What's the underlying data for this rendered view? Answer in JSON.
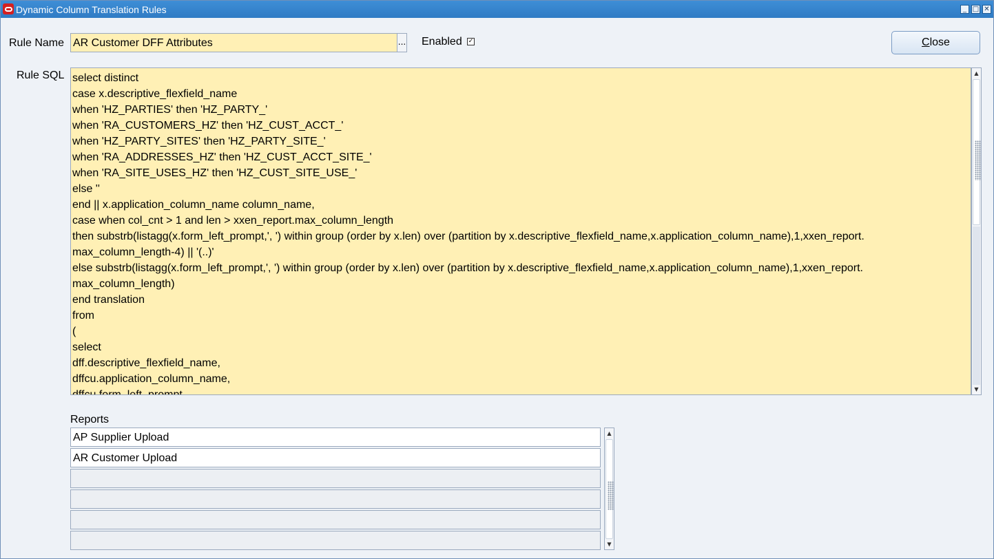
{
  "window": {
    "title": "Dynamic Column Translation Rules",
    "controls": [
      "_",
      "□",
      "✕"
    ]
  },
  "rule_name": {
    "label": "Rule Name",
    "value": "AR Customer DFF Attributes",
    "lov_label": "..."
  },
  "enabled": {
    "label": "Enabled",
    "checked": true,
    "mark": "✓"
  },
  "close_button": {
    "label": "Close",
    "mnemonic": "C"
  },
  "rule_sql": {
    "label": "Rule SQL",
    "lines": [
      "select distinct",
      "case x.descriptive_flexfield_name",
      "when 'HZ_PARTIES' then 'HZ_PARTY_'",
      "when 'RA_CUSTOMERS_HZ' then 'HZ_CUST_ACCT_'",
      "when 'HZ_PARTY_SITES' then 'HZ_PARTY_SITE_'",
      "when 'RA_ADDRESSES_HZ' then 'HZ_CUST_ACCT_SITE_'",
      "when 'RA_SITE_USES_HZ' then 'HZ_CUST_SITE_USE_'",
      "else ''",
      "end || x.application_column_name column_name,",
      "case when col_cnt > 1 and len > xxen_report.max_column_length",
      "then substrb(listagg(x.form_left_prompt,', ') within group (order by x.len) over (partition by x.descriptive_flexfield_name,x.application_column_name),1,xxen_report.",
      "max_column_length-4) || '(..)'",
      "else substrb(listagg(x.form_left_prompt,', ') within group (order by x.len) over (partition by x.descriptive_flexfield_name,x.application_column_name),1,xxen_report.",
      "max_column_length)",
      "end translation",
      "from",
      "(",
      "select",
      "dff.descriptive_flexfield_name,",
      "dffcu.application_column_name,",
      "dffcu.form_left_prompt,"
    ]
  },
  "reports": {
    "label": "Reports",
    "rows": [
      "AP Supplier Upload",
      "AR Customer Upload",
      "",
      "",
      "",
      ""
    ]
  },
  "icons": {
    "app": "oracle-icon",
    "scroll_up": "▲",
    "scroll_down": "▼"
  },
  "colors": {
    "titlebar": "#2f7bc4",
    "required_field": "#fff0b5",
    "window_bg": "#eef2f7"
  }
}
